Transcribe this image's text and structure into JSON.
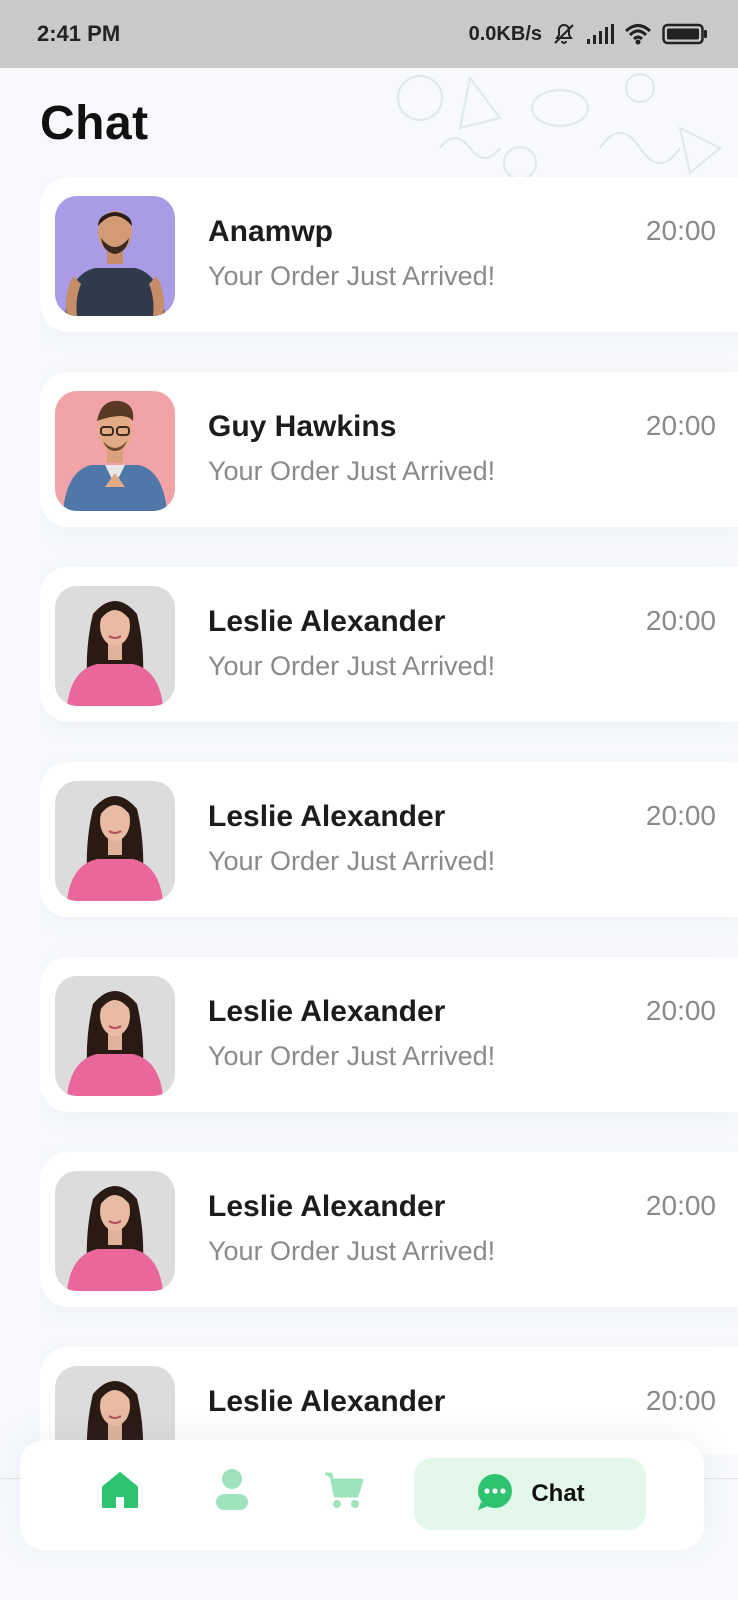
{
  "status_bar": {
    "time": "2:41 PM",
    "network_speed": "0.0KB/s",
    "icons": [
      "muted-bell-icon",
      "signal-icon",
      "wifi-icon",
      "battery-icon"
    ]
  },
  "page": {
    "title": "Chat"
  },
  "chats": [
    {
      "name": "Anamwp",
      "message": "Your Order Just Arrived!",
      "time": "20:00",
      "avatar": "man-blue-background"
    },
    {
      "name": "Guy Hawkins",
      "message": "Your Order Just Arrived!",
      "time": "20:00",
      "avatar": "man-pink-background"
    },
    {
      "name": "Leslie Alexander",
      "message": "Your Order Just Arrived!",
      "time": "20:00",
      "avatar": "woman-grey-background"
    },
    {
      "name": "Leslie Alexander",
      "message": "Your Order Just Arrived!",
      "time": "20:00",
      "avatar": "woman-grey-background"
    },
    {
      "name": "Leslie Alexander",
      "message": "Your Order Just Arrived!",
      "time": "20:00",
      "avatar": "woman-grey-background"
    },
    {
      "name": "Leslie Alexander",
      "message": "Your Order Just Arrived!",
      "time": "20:00",
      "avatar": "woman-grey-background"
    },
    {
      "name": "Leslie Alexander",
      "message": "",
      "time": "20:00",
      "avatar": "woman-grey-background"
    }
  ],
  "bottom_nav": {
    "items": [
      {
        "icon": "home-icon",
        "active": false
      },
      {
        "icon": "profile-icon",
        "active": false
      },
      {
        "icon": "cart-icon",
        "active": false
      },
      {
        "icon": "chat-icon",
        "label": "Chat",
        "active": true
      }
    ]
  },
  "colors": {
    "accent": "#2ec371",
    "accent_light": "#e3f7ea",
    "background": "#f7f9fc",
    "card": "#ffffff",
    "muted_text": "#8a8a8a"
  }
}
